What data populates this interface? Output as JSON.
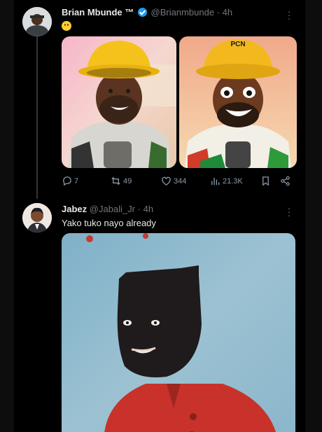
{
  "tweets": [
    {
      "author_name": "Brian Mbunde ™",
      "handle": "@Brianmbunde",
      "time": "4h",
      "text_emoji": "grinning-face-emoji",
      "stats": {
        "replies": "7",
        "retweets": "49",
        "likes": "344",
        "views": "21.3K"
      }
    },
    {
      "author_name": "Jabez",
      "handle": "@Jabali_Jr",
      "time": "4h",
      "text": "Yako tuko nayo already"
    }
  ],
  "separator": "·",
  "images": {
    "photo_cap_text": "",
    "cartoon_cap_text": "PCN"
  },
  "colors": {
    "background": "#000000",
    "verified": "#1d9bf0",
    "muted": "#71767b"
  }
}
